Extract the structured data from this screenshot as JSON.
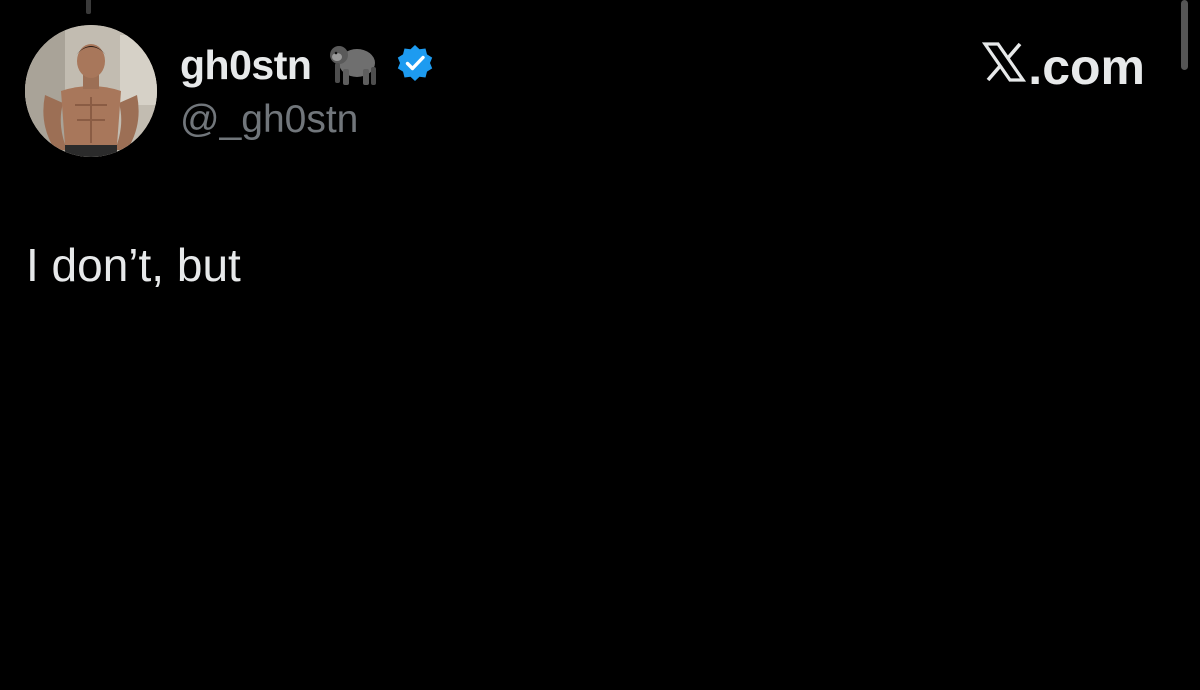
{
  "tweet": {
    "author": {
      "display_name": "gh0stn",
      "emoji_icon": "gorilla-icon",
      "verified_icon": "verified-badge-icon",
      "handle": "@_gh0stn"
    },
    "watermark_text": ".com",
    "watermark_icon": "x-logo-icon",
    "text": "I don’t, but"
  },
  "colors": {
    "background": "#000000",
    "primary_text": "#e7e9ea",
    "secondary_text": "#71767b",
    "verified": "#1d9bf0"
  }
}
